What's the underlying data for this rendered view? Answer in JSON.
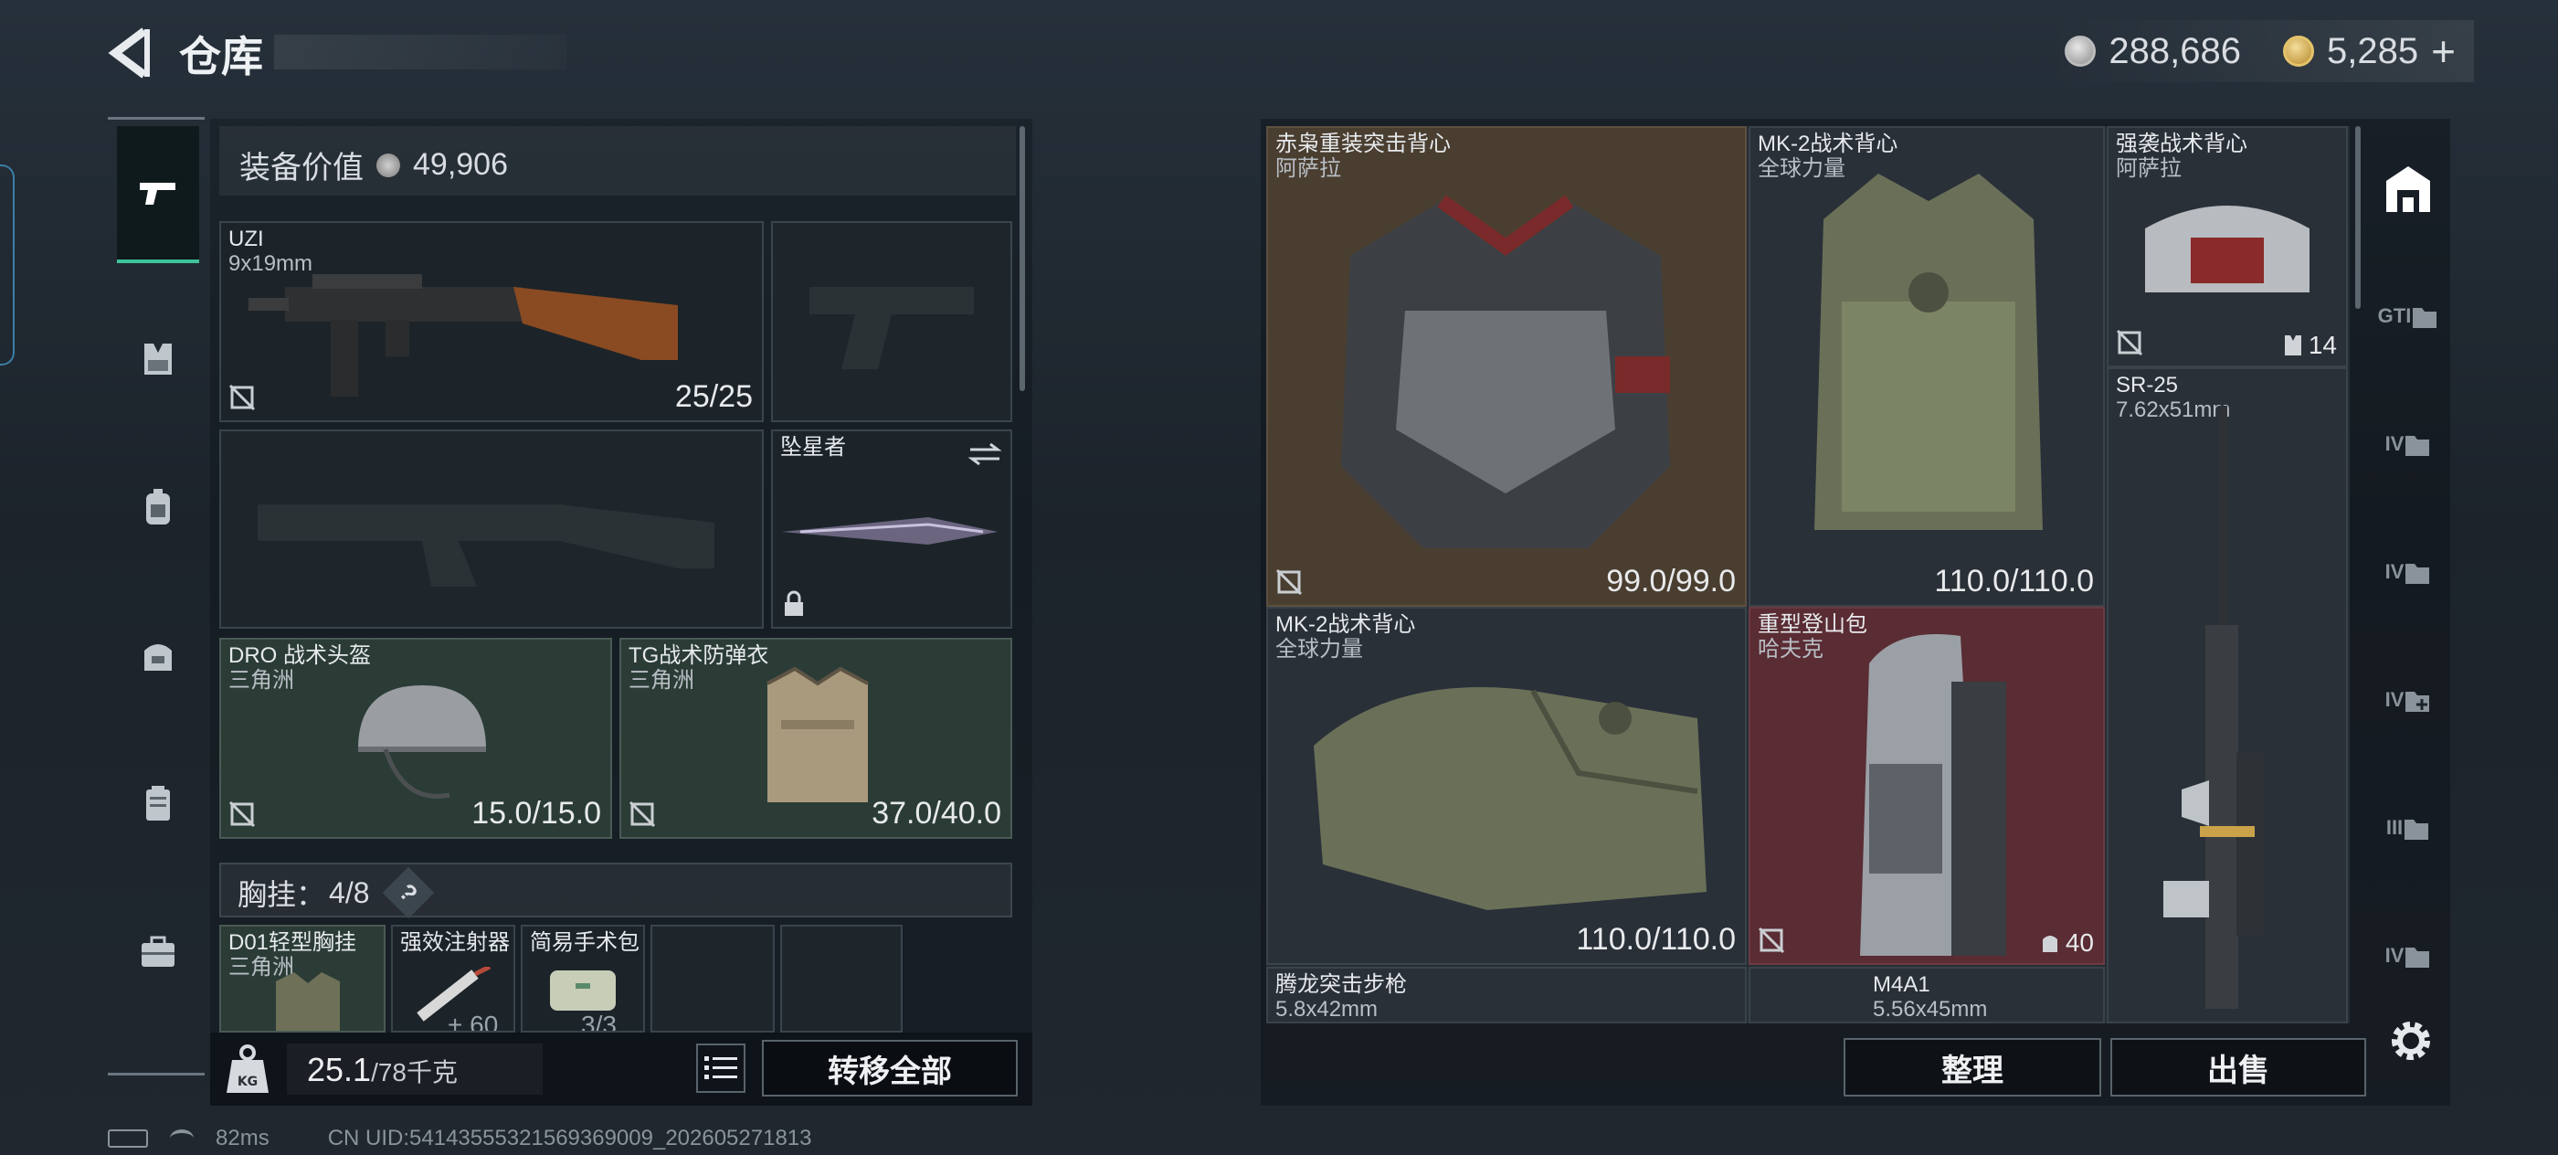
{
  "header": {
    "title": "仓库"
  },
  "currency": {
    "silver": "288,686",
    "gold": "5,285",
    "add_label": "+"
  },
  "equipment_value": {
    "label": "装备价值",
    "value": "49,906"
  },
  "loadout": {
    "primary": {
      "name": "UZI",
      "caliber": "9x19mm",
      "ammo": "25/25"
    },
    "melee": {
      "name": "坠星者"
    },
    "helmet": {
      "name": "DRO 战术头盔",
      "maker": "三角洲",
      "durability": "15.0/15.0"
    },
    "armor": {
      "name": "TG战术防弹衣",
      "maker": "三角洲",
      "durability": "37.0/40.0"
    },
    "chest_rig": {
      "label": "胸挂：",
      "capacity": "4/8",
      "help": "?"
    },
    "rig_items": [
      {
        "name": "D01轻型胸挂",
        "maker": "三角洲"
      },
      {
        "name": "强效注射器",
        "count": "60"
      },
      {
        "name": "简易手术包",
        "count": "3/3"
      }
    ],
    "weight": {
      "value": "25.1",
      "max": "/78千克"
    },
    "transfer_label": "转移全部"
  },
  "stash": {
    "items": [
      {
        "name": "赤枭重装突击背心",
        "maker": "阿萨拉",
        "durability": "99.0/99.0"
      },
      {
        "name": "MK-2战术背心",
        "maker": "全球力量",
        "durability": "110.0/110.0"
      },
      {
        "name": "强袭战术背心",
        "maker": "阿萨拉",
        "count": "14"
      },
      {
        "name": "SR-25",
        "caliber": "7.62x51mm"
      },
      {
        "name": "MK-2战术背心",
        "maker": "全球力量",
        "durability": "110.0/110.0"
      },
      {
        "name": "重型登山包",
        "maker": "哈夫克",
        "count": "40"
      },
      {
        "name": "腾龙突击步枪",
        "caliber": "5.8x42mm"
      },
      {
        "name": "M4A1",
        "caliber": "5.56x45mm"
      }
    ],
    "arrange_label": "整理",
    "sell_label": "出售"
  },
  "right_rail": [
    "GTI",
    "IV",
    "IV",
    "IV",
    "III",
    "IV"
  ],
  "footer": {
    "ping": "82ms",
    "uid": "CN UID:54143555321569369009_202605271813"
  },
  "colors": {
    "accent_green": "#3fc398",
    "red_slot": "#5a2c33",
    "brown_slot": "#4a3e30",
    "slot_green": "#2b3c37"
  }
}
